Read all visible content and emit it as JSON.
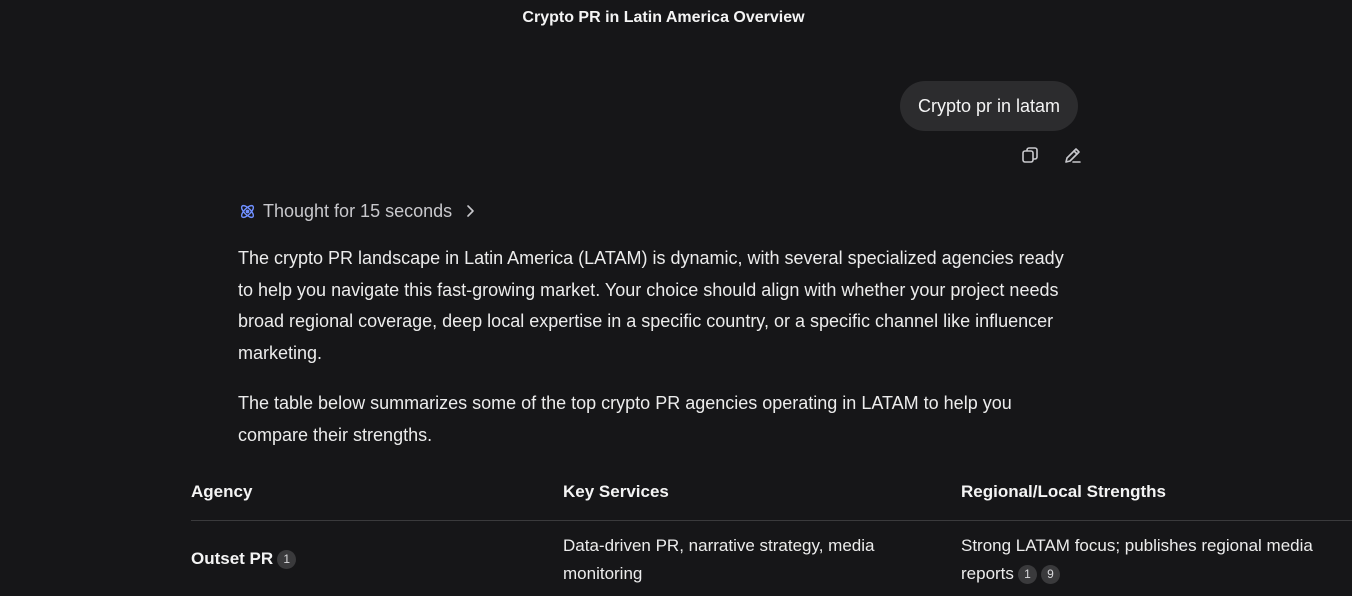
{
  "header": {
    "title": "Crypto PR in Latin America Overview"
  },
  "user_message": {
    "text": "Crypto pr in latam"
  },
  "icons": {
    "copy": "copy-icon",
    "edit": "pencil-icon",
    "thought": "atom-icon",
    "expand": "chevron-right-icon"
  },
  "colors": {
    "background": "#161618",
    "bubble": "#2c2c2e",
    "thought_icon": "#6f8fff",
    "citation_bg": "#3a3a3c"
  },
  "thought": {
    "label": "Thought for 15 seconds"
  },
  "response": {
    "paragraphs": [
      "The crypto PR landscape in Latin America (LATAM) is dynamic, with several specialized agencies ready to help you navigate this fast-growing market. Your choice should align with whether your project needs broad regional coverage, deep local expertise in a specific country, or a specific channel like influencer marketing.",
      "The table below summarizes some of the top crypto PR agencies operating in LATAM to help you compare their strengths."
    ]
  },
  "table": {
    "headers": [
      "Agency",
      "Key Services",
      "Regional/Local Strengths"
    ],
    "rows": [
      {
        "agency": "Outset PR",
        "agency_citations": [
          "1"
        ],
        "services": "Data-driven PR, narrative strategy, media monitoring",
        "strengths": "Strong LATAM focus; publishes regional media reports",
        "strengths_citations": [
          "1",
          "9"
        ]
      }
    ]
  }
}
